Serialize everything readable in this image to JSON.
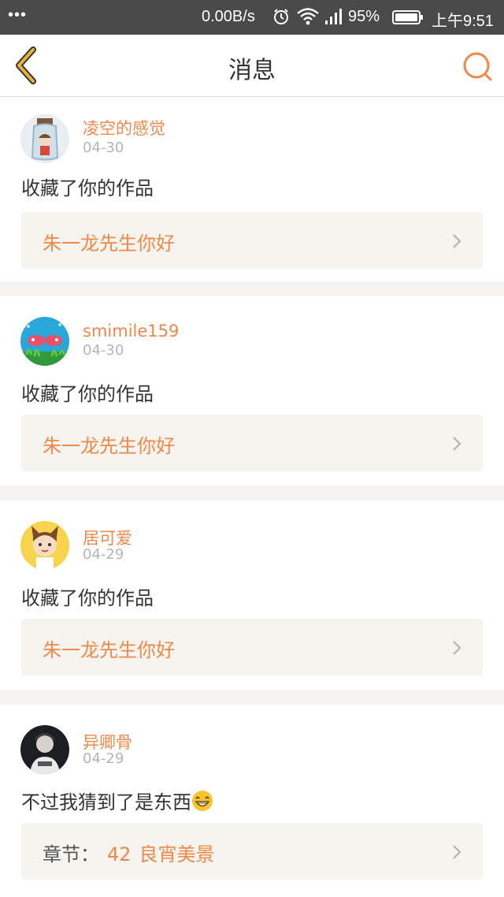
{
  "status_bar": {
    "dots": "•••",
    "network_speed": "0.00B/s",
    "battery_percent": "95%",
    "time": "上午9:51"
  },
  "nav": {
    "title": "消息",
    "back_icon": "chevron-left-icon",
    "search_icon": "search-icon"
  },
  "colors": {
    "accent": "#f0884a",
    "back_icon": "#e8b23a",
    "link_bg": "#f5f4ef"
  },
  "messages": [
    {
      "username": "凌空的感觉",
      "date": "04-30",
      "action": "收藏了你的作品",
      "link": {
        "text": "朱一龙先生你好"
      }
    },
    {
      "username": "smimile159",
      "date": "04-30",
      "action": "收藏了你的作品",
      "link": {
        "text": "朱一龙先生你好"
      }
    },
    {
      "username": "居可爱",
      "date": "04-29",
      "action": "收藏了你的作品",
      "link": {
        "text": "朱一龙先生你好"
      }
    },
    {
      "username": "异卿骨",
      "date": "04-29",
      "action": "不过我猜到了是东西",
      "action_emoji": "grinning-face-emoji",
      "link": {
        "prefix": "章节：",
        "number": "42",
        "text": "良宵美景"
      }
    }
  ]
}
